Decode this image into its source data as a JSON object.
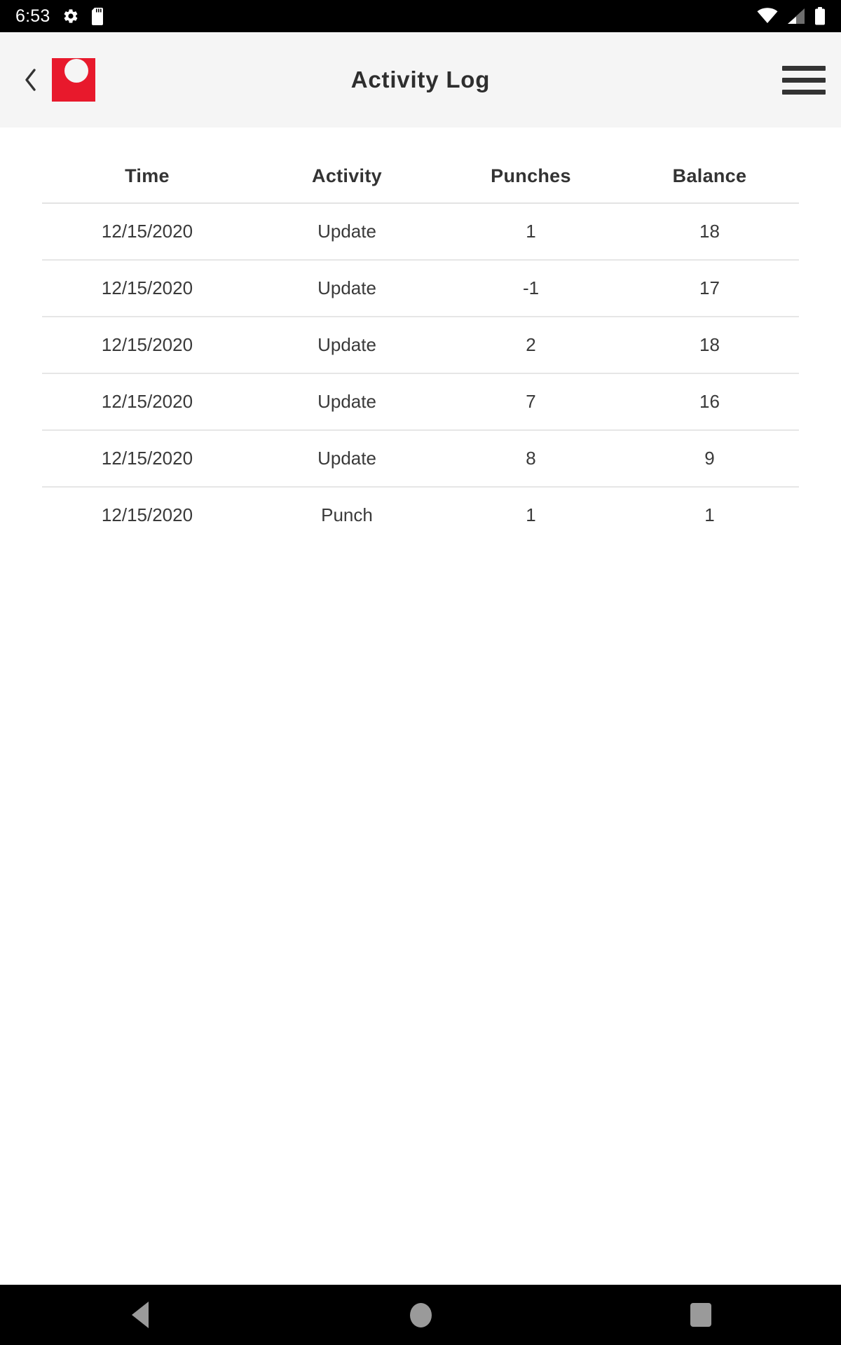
{
  "status_bar": {
    "clock": "6:53",
    "left_icons": [
      "gear-icon",
      "sdcard-icon"
    ],
    "right_icons": [
      "wifi-icon",
      "cellular-signal-icon",
      "battery-icon"
    ],
    "background_color": "#000000",
    "foreground_color": "#ffffff"
  },
  "app_bar": {
    "back_label": "‹",
    "title": "Activity Log",
    "logo_name": "brand-logo",
    "menu_name": "hamburger-menu",
    "background_color": "#f5f5f5",
    "brand_color": "#e8192c"
  },
  "table": {
    "columns": [
      "Time",
      "Activity",
      "Punches",
      "Balance"
    ],
    "rows": [
      {
        "time": "12/15/2020",
        "activity": "Update",
        "punches": "1",
        "balance": "18"
      },
      {
        "time": "12/15/2020",
        "activity": "Update",
        "punches": "-1",
        "balance": "17"
      },
      {
        "time": "12/15/2020",
        "activity": "Update",
        "punches": "2",
        "balance": "18"
      },
      {
        "time": "12/15/2020",
        "activity": "Update",
        "punches": "7",
        "balance": "16"
      },
      {
        "time": "12/15/2020",
        "activity": "Update",
        "punches": "8",
        "balance": "9"
      },
      {
        "time": "12/15/2020",
        "activity": "Punch",
        "punches": "1",
        "balance": "1"
      }
    ]
  },
  "nav_bar": {
    "buttons": [
      "back-triangle",
      "home-circle",
      "recents-square"
    ],
    "background_color": "#000000",
    "icon_color": "#9a9a9a"
  }
}
